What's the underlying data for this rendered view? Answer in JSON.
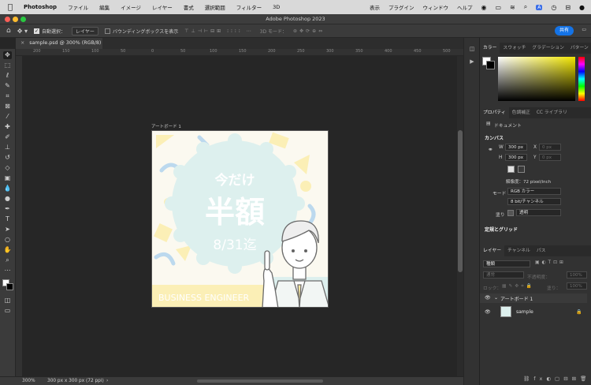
{
  "menubar": {
    "app": "Photoshop",
    "items": [
      "ファイル",
      "編集",
      "イメージ",
      "レイヤー",
      "書式",
      "選択範囲",
      "フィルター",
      "3D"
    ],
    "right_items": [
      "表示",
      "プラグイン",
      "ウィンドウ",
      "ヘルプ"
    ]
  },
  "window": {
    "title": "Adobe Photoshop 2023"
  },
  "options": {
    "auto_select_label": "自動選択：",
    "auto_select_value": "レイヤー",
    "bounding_box_label": "バウンディングボックスを表示",
    "mode_3d": "3D モード：",
    "share_label": "共有"
  },
  "document": {
    "tab_label": "sample.psd @ 300% (RGB/8)",
    "close_symbol": "×"
  },
  "ruler": {
    "ticks": [
      "200",
      "150",
      "100",
      "50",
      "0",
      "50",
      "100",
      "150",
      "200",
      "250",
      "300",
      "350",
      "400",
      "450",
      "500"
    ]
  },
  "artboard": {
    "label": "アートボード 1",
    "line1": "今だけ",
    "line2": "半額",
    "line3": "8/31迄",
    "banner": "BUSINESS ENGINEER"
  },
  "status": {
    "zoom": "300%",
    "info": "300 px x 300 px (72 ppi)",
    "arrow": "›"
  },
  "color_panel": {
    "tabs": [
      "カラー",
      "スウォッチ",
      "グラデーション",
      "パターン"
    ]
  },
  "properties_panel": {
    "tabs": [
      "プロパティ",
      "色調補正",
      "CC ライブラリ"
    ],
    "doc_label": "ドキュメント",
    "canvas_section": "カンバス",
    "w_label": "W",
    "w_value": "300 px",
    "h_label": "H",
    "h_value": "300 px",
    "x_label": "X",
    "x_value": "0 px",
    "y_label": "Y",
    "y_value": "0 px",
    "resolution": "解像度：72 pixel/inch",
    "mode_label": "モード",
    "mode_value": "RGB カラー",
    "depth_value": "8 bit/チャンネル",
    "fill_label": "塗り",
    "fill_value": "透明",
    "guides_section": "定規とグリッド"
  },
  "layers_panel": {
    "tabs": [
      "レイヤー",
      "チャンネル",
      "パス"
    ],
    "filter_value": "種類",
    "blend_value": "通常",
    "opacity_label": "不透明度：",
    "opacity_value": "100%",
    "lock_label": "ロック：",
    "fill_label": "塗り：",
    "fill_value": "100%",
    "layers": [
      {
        "name": "アートボード 1"
      },
      {
        "name": "sample"
      }
    ]
  },
  "colors": {
    "accent": "#1473e6",
    "art_mint": "#ddf0ee",
    "art_yellow": "#fbefb6",
    "art_blue": "#bcd9ee"
  }
}
